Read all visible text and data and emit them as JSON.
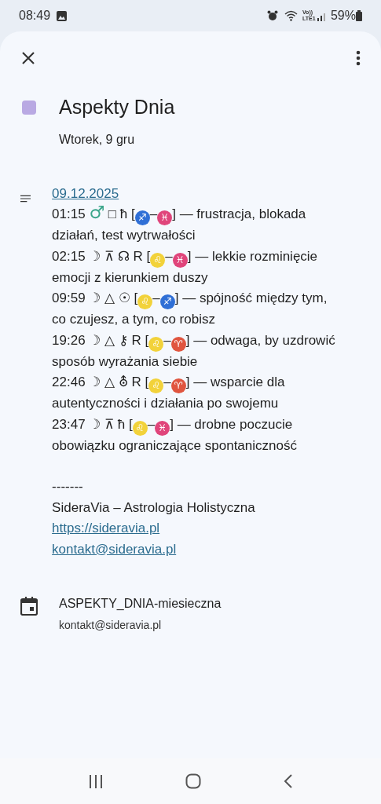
{
  "status_bar": {
    "time": "08:49",
    "battery": "59%",
    "network": "Vo)) LTE1"
  },
  "event": {
    "title": "Aspekty Dnia",
    "color": "#b9a9e3",
    "date": "Wtorek, 9 gru"
  },
  "description": {
    "date_link": "09.12.2025",
    "entries": [
      [
        {
          "kind": "text",
          "text": "01:15 "
        },
        {
          "kind": "glyph",
          "text": "♂",
          "color": "#3aa58a"
        },
        {
          "kind": "text",
          "text": " □ ħ ["
        },
        {
          "kind": "sign",
          "text": "♐",
          "color": "#2f6fd6"
        },
        {
          "kind": "text",
          "text": "–"
        },
        {
          "kind": "sign",
          "text": "♓",
          "color": "#e0457b"
        },
        {
          "kind": "text",
          "text": "] — frustracja, blokada działań, test wytrwałości"
        }
      ],
      [
        {
          "kind": "text",
          "text": "02:15 ☽ ⊼ ☊ R ["
        },
        {
          "kind": "sign",
          "text": "♌",
          "color": "#f2d23a"
        },
        {
          "kind": "text",
          "text": "–"
        },
        {
          "kind": "sign",
          "text": "♓",
          "color": "#e0457b"
        },
        {
          "kind": "text",
          "text": "] — lekkie rozminięcie emocji z kierunkiem duszy"
        }
      ],
      [
        {
          "kind": "text",
          "text": "09:59 ☽ △ ☉ ["
        },
        {
          "kind": "sign",
          "text": "♌",
          "color": "#f2d23a"
        },
        {
          "kind": "text",
          "text": "–"
        },
        {
          "kind": "sign",
          "text": "♐",
          "color": "#2f6fd6"
        },
        {
          "kind": "text",
          "text": "] — spójność między tym, co czujesz, a tym, co robisz"
        }
      ],
      [
        {
          "kind": "text",
          "text": "19:26 ☽ △ ⚷ R ["
        },
        {
          "kind": "sign",
          "text": "♌",
          "color": "#f2d23a"
        },
        {
          "kind": "text",
          "text": "–"
        },
        {
          "kind": "sign",
          "text": "♈",
          "color": "#e0553f"
        },
        {
          "kind": "text",
          "text": "] — odwaga, by uzdrowić sposób wyrażania siebie"
        }
      ],
      [
        {
          "kind": "text",
          "text": "22:46 ☽ △ ⛢ R ["
        },
        {
          "kind": "sign",
          "text": "♌",
          "color": "#f2d23a"
        },
        {
          "kind": "text",
          "text": "–"
        },
        {
          "kind": "sign",
          "text": "♈",
          "color": "#e0553f"
        },
        {
          "kind": "text",
          "text": "] — wsparcie dla autentyczności i działania po swojemu"
        }
      ],
      [
        {
          "kind": "text",
          "text": "23:47 ☽ ⊼ ħ ["
        },
        {
          "kind": "sign",
          "text": "♌",
          "color": "#f2d23a"
        },
        {
          "kind": "text",
          "text": "–"
        },
        {
          "kind": "sign",
          "text": "♓",
          "color": "#e0457b"
        },
        {
          "kind": "text",
          "text": "] — drobne poczucie obowiązku ograniczające spontaniczność"
        }
      ]
    ],
    "separator": "-------",
    "signature": "SideraVia – Astrologia Holistyczna",
    "links": [
      "https://sideravia.pl",
      "kontakt@sideravia.pl"
    ]
  },
  "calendar": {
    "name": "ASPEKTY_DNIA-miesieczna",
    "account": "kontakt@sideravia.pl"
  }
}
